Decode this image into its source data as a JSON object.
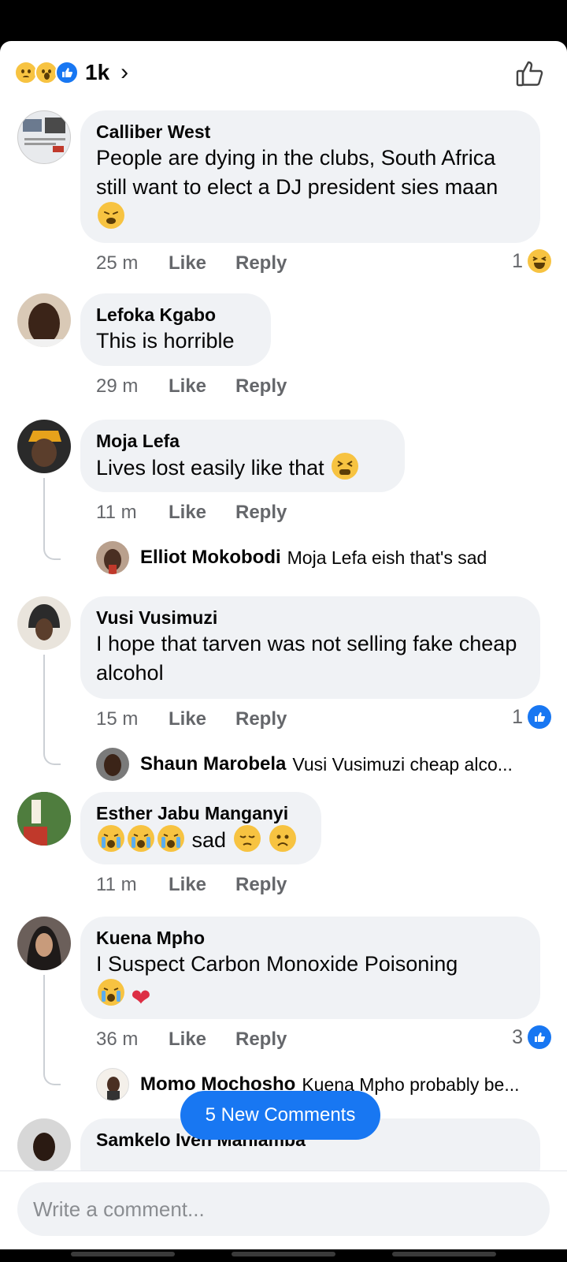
{
  "header": {
    "reaction_emojis": [
      "sad",
      "wow",
      "like"
    ],
    "reaction_count": "1k",
    "chevron": "›"
  },
  "comments": [
    {
      "author": "Calliber West",
      "text": "People are dying in the clubs, South Africa still want to elect a DJ president sies maan",
      "trailing_emoji": "weary-face",
      "time": "25 m",
      "like_label": "Like",
      "reply_label": "Reply",
      "reactions": {
        "count": "1",
        "type": "haha"
      }
    },
    {
      "author": "Lefoka Kgabo",
      "text": "This is horrible",
      "time": "29 m",
      "like_label": "Like",
      "reply_label": "Reply"
    },
    {
      "author": "Moja Lefa",
      "text": "Lives lost easily like that",
      "trailing_emoji": "tired-face",
      "time": "11 m",
      "like_label": "Like",
      "reply_label": "Reply",
      "reply_preview": {
        "author": "Elliot Mokobodi",
        "text": "Moja Lefa eish that's sad"
      }
    },
    {
      "author": "Vusi Vusimuzi",
      "text": "I hope that tarven was not selling fake cheap alcohol",
      "time": "15 m",
      "like_label": "Like",
      "reply_label": "Reply",
      "reactions": {
        "count": "1",
        "type": "like"
      },
      "reply_preview": {
        "author": "Shaun Marobela",
        "text": "Vusi Vusimuzi cheap alco..."
      }
    },
    {
      "author": "Esther Jabu Manganyi",
      "text_word": "sad",
      "time": "11 m",
      "like_label": "Like",
      "reply_label": "Reply"
    },
    {
      "author": "Kuena Mpho",
      "text": "I Suspect Carbon Monoxide Poisoning",
      "time": "36 m",
      "like_label": "Like",
      "reply_label": "Reply",
      "reactions": {
        "count": "3",
        "type": "like"
      },
      "reply_preview": {
        "author": "Momo Mochosho",
        "text": "Kuena Mpho probably be..."
      }
    },
    {
      "author": "Samkelo Iven Mahlamba"
    }
  ],
  "new_comments_label": "5 New Comments",
  "composer": {
    "placeholder": "Write a comment..."
  },
  "colors": {
    "accent": "#1877f2",
    "bubble": "#f0f2f5",
    "meta": "#65676b"
  }
}
